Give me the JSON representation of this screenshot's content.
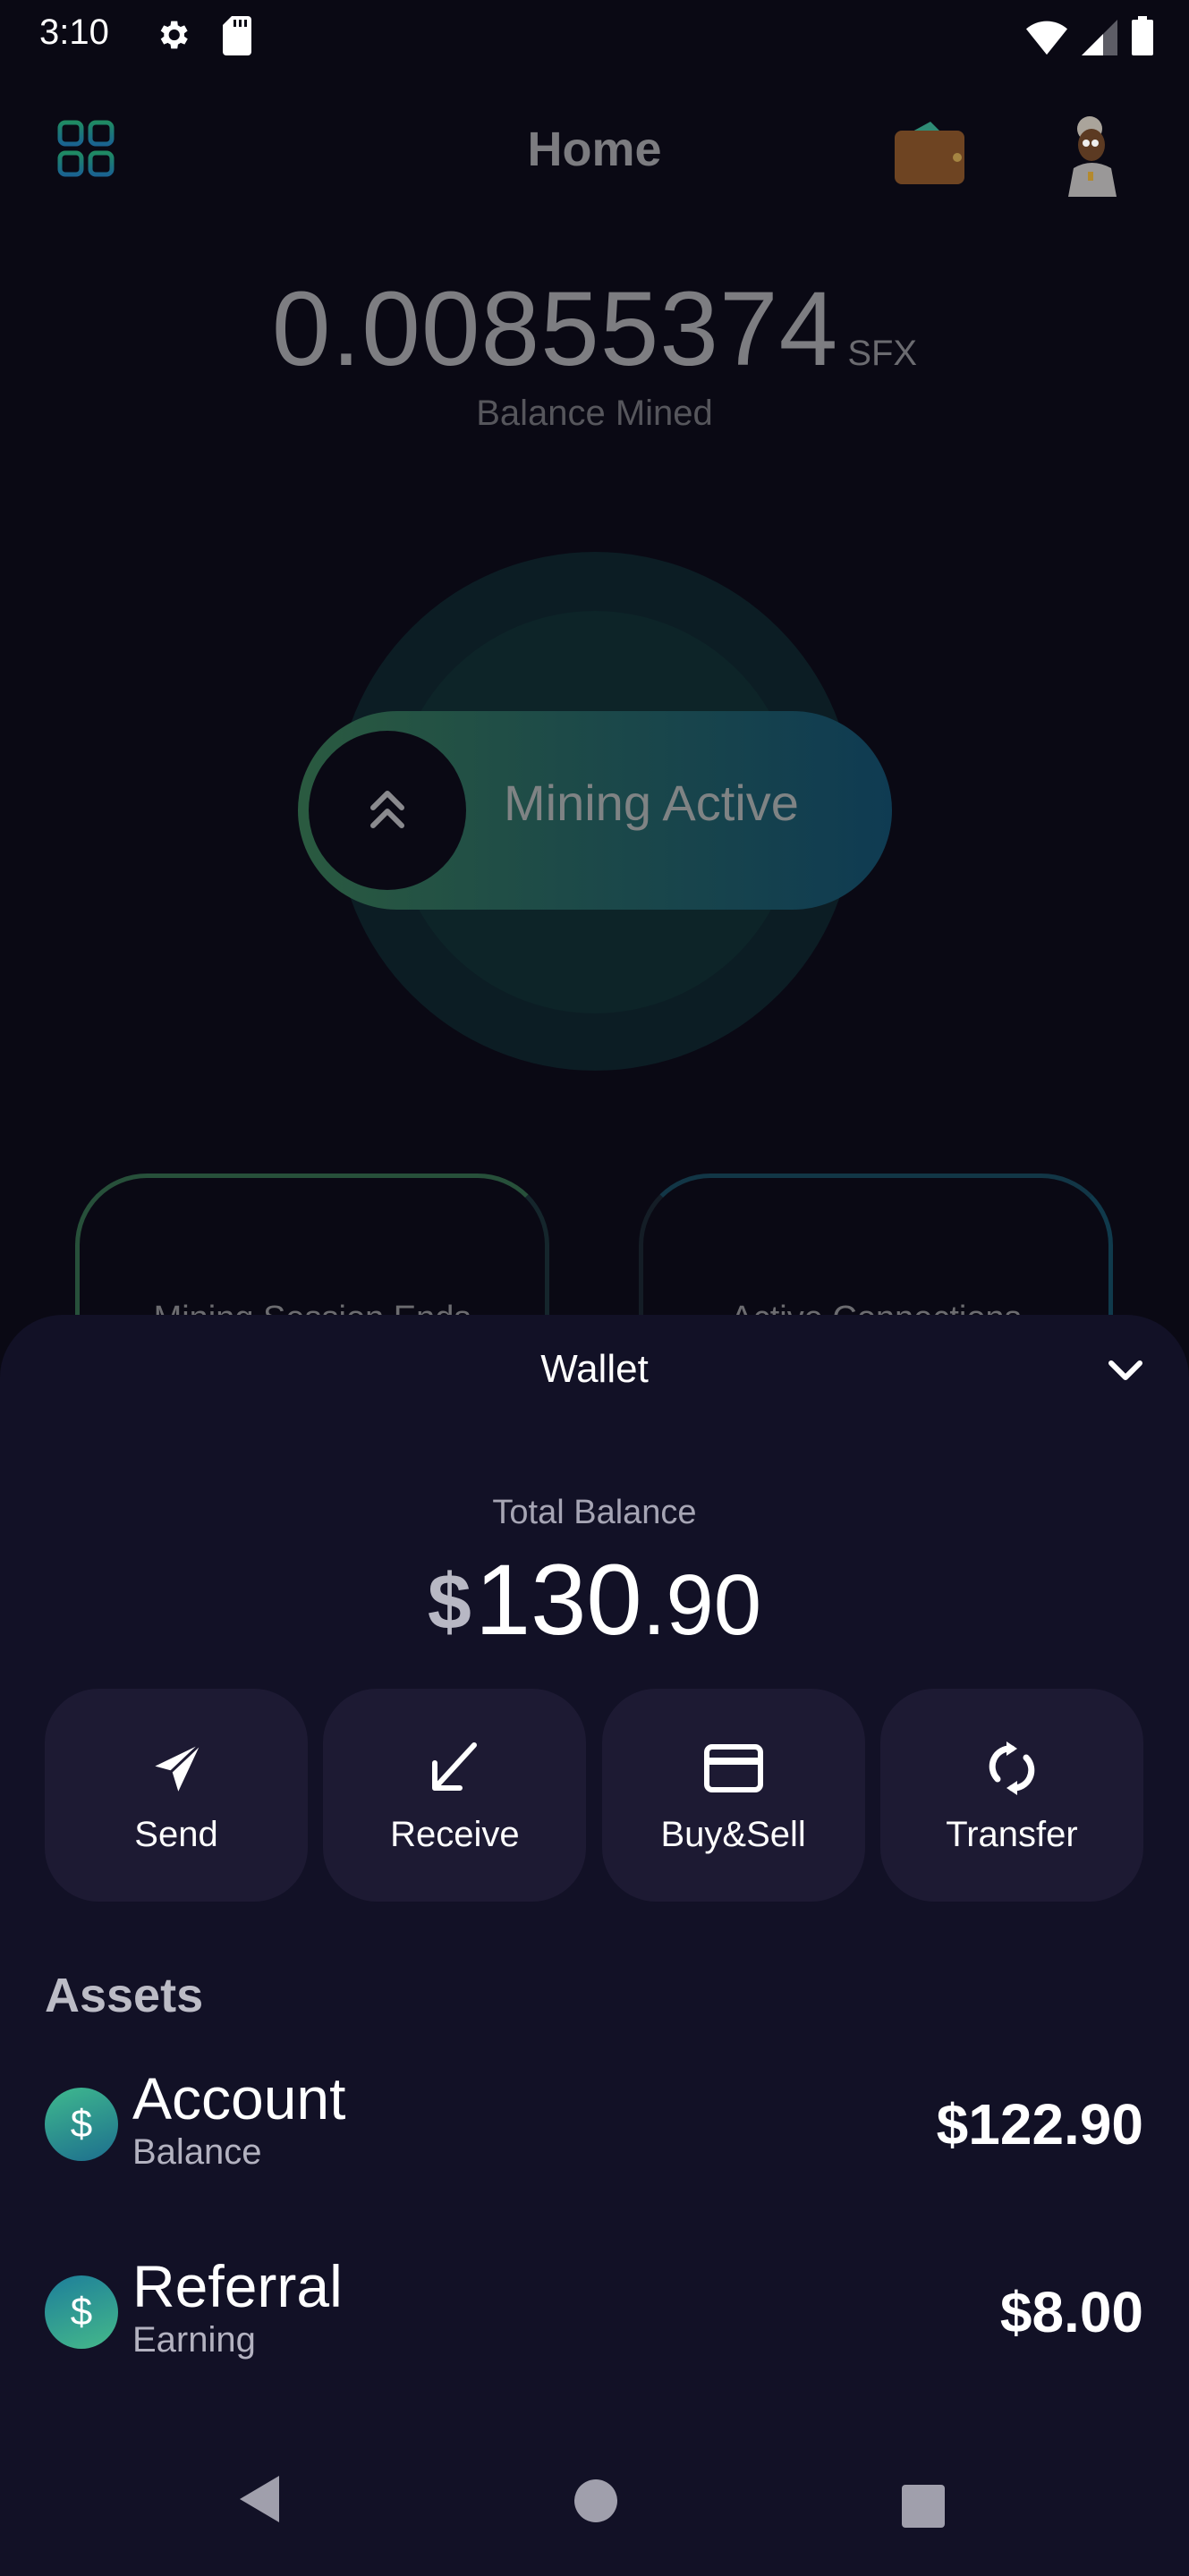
{
  "status_bar": {
    "time": "3:10",
    "left_icons": [
      "gear-icon",
      "sd-card-icon"
    ],
    "right_icons": [
      "wifi-icon",
      "signal-icon",
      "battery-icon"
    ]
  },
  "app_bar": {
    "title": "Home",
    "menu_icon": "grid-icon",
    "wallet_icon": "wallet-icon",
    "avatar": "avatar"
  },
  "mined": {
    "value": "0.00855374",
    "unit": "SFX",
    "label": "Balance Mined"
  },
  "mining": {
    "status_label": "Mining Active",
    "knob_icon": "double-chevron-up-icon"
  },
  "stat_cards": [
    {
      "label": "Mining Session Ends"
    },
    {
      "label": "Active Connections"
    }
  ],
  "wallet": {
    "title": "Wallet",
    "collapse_icon": "chevron-down-icon",
    "total_label": "Total Balance",
    "total_currency": "$",
    "total_integer": "130",
    "total_decimal": ".90",
    "actions": [
      {
        "label": "Send",
        "icon": "send-icon"
      },
      {
        "label": "Receive",
        "icon": "receive-icon"
      },
      {
        "label": "Buy&Sell",
        "icon": "card-icon"
      },
      {
        "label": "Transfer",
        "icon": "transfer-icon"
      }
    ],
    "assets_title": "Assets",
    "assets": [
      {
        "name": "Account",
        "sub": "Balance",
        "value": "$122.90",
        "icon_symbol": "$"
      },
      {
        "name": "Referral",
        "sub": "Earning",
        "value": "$8.00",
        "icon_symbol": "$"
      }
    ]
  },
  "nav_bar": {
    "buttons": [
      "back",
      "home",
      "recents"
    ]
  },
  "colors": {
    "background": "#0a0914",
    "sheet": "#121126",
    "action_button": "#1d1a33",
    "accent_green": "#2a5a40",
    "accent_blue": "#0f3b52"
  }
}
